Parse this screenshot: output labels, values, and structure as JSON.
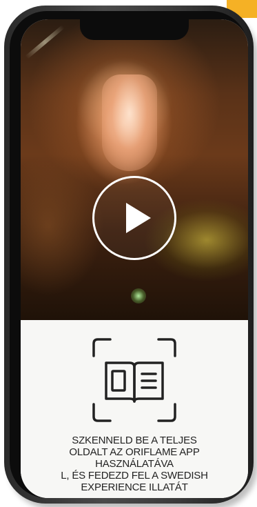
{
  "video": {
    "play_icon": "play-icon"
  },
  "scan_prompt": {
    "icon": "scan-book-icon",
    "lines": [
      "SZKENNELD BE A TELJES",
      "OLDALT AZ ORIFLAME APP",
      "HASZNÁLATÁVA",
      "L, ÉS FEDEZD FEL A SWEDISH",
      "EXPERIENCE ILLATÁT"
    ]
  },
  "colors": {
    "accent": "#f5b125",
    "panel_background": "#f7f7f5",
    "text": "#222222",
    "phone_frame": "#2a2a2a"
  }
}
